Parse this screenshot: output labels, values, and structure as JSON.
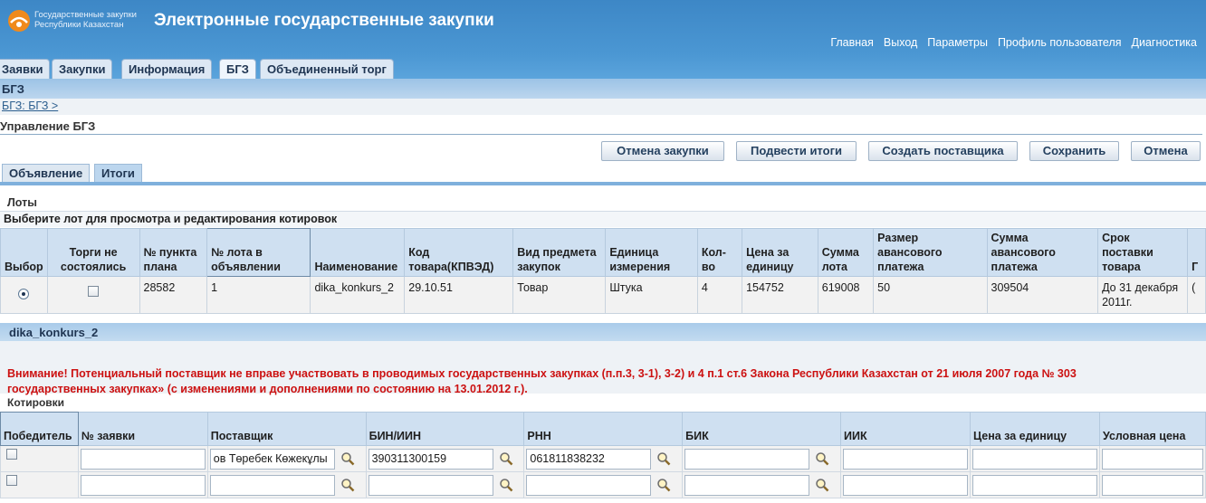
{
  "header": {
    "logo_line1": "Государственные закупки",
    "logo_line2": "Республики Казахстан",
    "app_title": "Электронные государственные закупки",
    "nav": [
      "Главная",
      "Выход",
      "Параметры",
      "Профиль пользователя",
      "Диагностика"
    ]
  },
  "tabs": [
    "Заявки",
    "Закупки",
    "Информация",
    "БГЗ",
    "Объединенный торг"
  ],
  "band_title": "БГЗ",
  "breadcrumb": "БГЗ: БГЗ  >",
  "page_title": "Управление БГЗ",
  "buttons": {
    "cancel_purchase": "Отмена закупки",
    "summarize": "Подвести итоги",
    "create_supplier": "Создать поставщика",
    "save": "Сохранить",
    "cancel": "Отмена"
  },
  "subtabs": [
    "Объявление",
    "Итоги"
  ],
  "lots": {
    "label": "Лоты",
    "hint": "Выберите лот для просмотра и редактирования котировок",
    "headers": [
      "Выбор",
      "Торги не состоялись",
      "№ пункта плана",
      "№ лота в объявлении",
      "Наименование",
      "Код товара(КПВЭД)",
      "Вид предмета закупок",
      "Единица измерения",
      "Кол-во",
      "Цена за единицу",
      "Сумма лота",
      "Размер авансового платежа",
      "Сумма авансового платежа",
      "Срок поставки товара",
      "Г"
    ],
    "row": {
      "plan_no": "28582",
      "lot_no": "1",
      "name": "dika_konkurs_2",
      "code": "29.10.51",
      "type": "Товар",
      "unit": "Штука",
      "qty": "4",
      "price": "154752",
      "sum": "619008",
      "advance_size": "50",
      "advance_sum": "309504",
      "delivery": "До 31 декабря 2011г.",
      "extra": "("
    }
  },
  "section2": {
    "title": "dika_konkurs_2",
    "warning_line1": "Внимание! Потенциальный поставщик не вправе участвовать в проводимых государственных закупках (п.п.3, 3-1), 3-2) и 4 п.1 ст.6 Закона Республики Казахстан от 21 июля 2007 года № 303",
    "warning_line2": "государственных закупках» (с изменениями и дополнениями по состоянию на 13.01.2012 г.).",
    "quotes_label": "Котировки"
  },
  "quotes": {
    "headers": [
      "Победитель",
      "№ заявки",
      "Поставщик",
      "БИН/ИИН",
      "РНН",
      "БИК",
      "ИИК",
      "Цена за единицу",
      "Условная цена"
    ],
    "rows": [
      {
        "app_no": "",
        "supplier": "ов Төребек Көжекұлы",
        "bin": "390311300159",
        "rnn": "061811838232",
        "bik": "",
        "iik": "",
        "price": "",
        "cond_price": ""
      },
      {
        "app_no": "",
        "supplier": "",
        "bin": "",
        "rnn": "",
        "bik": "",
        "iik": "",
        "price": "",
        "cond_price": ""
      }
    ]
  },
  "colors": {
    "header_blue": "#3d87c6",
    "warning_red": "#cc1111",
    "table_header": "#cfe0f1"
  }
}
